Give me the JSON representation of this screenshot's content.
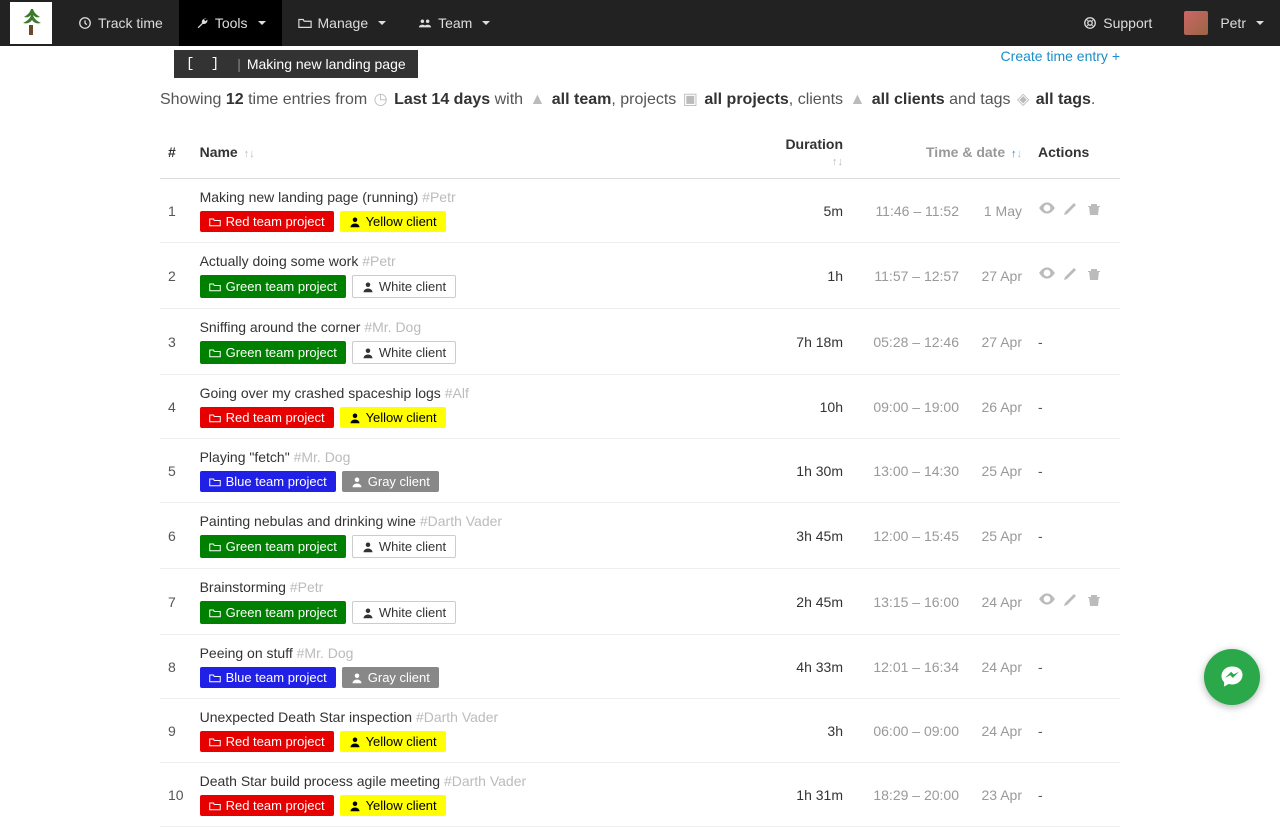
{
  "navbar": {
    "track_time": "Track time",
    "tools": "Tools",
    "manage": "Manage",
    "team": "Team",
    "support": "Support",
    "user_name": "Petr"
  },
  "breadcrumb": {
    "brackets": "[  ]",
    "title": "Making new landing page"
  },
  "create_link": "Create time entry",
  "filter": {
    "prefix": "Showing ",
    "count": "12",
    "after_count": " time entries from ",
    "range": "Last 14 days",
    "with": " with ",
    "team": "all team",
    "projects_label": ", projects ",
    "projects": "all projects",
    "clients_label": ", clients ",
    "clients": "all clients",
    "tags_label": " and tags ",
    "tags": "all tags",
    "period": "."
  },
  "columns": {
    "idx": "#",
    "name": "Name",
    "duration": "Duration",
    "timedate": "Time & date",
    "actions": "Actions"
  },
  "entries": [
    {
      "idx": "1",
      "title": "Making new landing page (running)",
      "assignee": "#Petr",
      "project": {
        "label": "Red team project",
        "class": "badge-red"
      },
      "client": {
        "label": "Yellow client",
        "class": "badge-yellow"
      },
      "duration": "5m",
      "time": "11:46 – 11:52",
      "date": "1 May",
      "actions": true
    },
    {
      "idx": "2",
      "title": "Actually doing some work",
      "assignee": "#Petr",
      "project": {
        "label": "Green team project",
        "class": "badge-green"
      },
      "client": {
        "label": "White client",
        "class": "badge-white"
      },
      "duration": "1h",
      "time": "11:57 – 12:57",
      "date": "27 Apr",
      "actions": true
    },
    {
      "idx": "3",
      "title": "Sniffing around the corner",
      "assignee": "#Mr. Dog",
      "project": {
        "label": "Green team project",
        "class": "badge-green"
      },
      "client": {
        "label": "White client",
        "class": "badge-white"
      },
      "duration": "7h 18m",
      "time": "05:28 – 12:46",
      "date": "27 Apr",
      "actions": false
    },
    {
      "idx": "4",
      "title": "Going over my crashed spaceship logs",
      "assignee": "#Alf",
      "project": {
        "label": "Red team project",
        "class": "badge-red"
      },
      "client": {
        "label": "Yellow client",
        "class": "badge-yellow"
      },
      "duration": "10h",
      "time": "09:00 – 19:00",
      "date": "26 Apr",
      "actions": false
    },
    {
      "idx": "5",
      "title": "Playing \"fetch\"",
      "assignee": "#Mr. Dog",
      "project": {
        "label": "Blue team project",
        "class": "badge-blue"
      },
      "client": {
        "label": "Gray client",
        "class": "badge-gray"
      },
      "duration": "1h 30m",
      "time": "13:00 – 14:30",
      "date": "25 Apr",
      "actions": false
    },
    {
      "idx": "6",
      "title": "Painting nebulas and drinking wine",
      "assignee": "#Darth Vader",
      "project": {
        "label": "Green team project",
        "class": "badge-green"
      },
      "client": {
        "label": "White client",
        "class": "badge-white"
      },
      "duration": "3h 45m",
      "time": "12:00 – 15:45",
      "date": "25 Apr",
      "actions": false
    },
    {
      "idx": "7",
      "title": "Brainstorming",
      "assignee": "#Petr",
      "project": {
        "label": "Green team project",
        "class": "badge-green"
      },
      "client": {
        "label": "White client",
        "class": "badge-white"
      },
      "duration": "2h 45m",
      "time": "13:15 – 16:00",
      "date": "24 Apr",
      "actions": true
    },
    {
      "idx": "8",
      "title": "Peeing on stuff",
      "assignee": "#Mr. Dog",
      "project": {
        "label": "Blue team project",
        "class": "badge-blue"
      },
      "client": {
        "label": "Gray client",
        "class": "badge-gray"
      },
      "duration": "4h 33m",
      "time": "12:01 – 16:34",
      "date": "24 Apr",
      "actions": false
    },
    {
      "idx": "9",
      "title": "Unexpected Death Star inspection",
      "assignee": "#Darth Vader",
      "project": {
        "label": "Red team project",
        "class": "badge-red"
      },
      "client": {
        "label": "Yellow client",
        "class": "badge-yellow"
      },
      "duration": "3h",
      "time": "06:00 – 09:00",
      "date": "24 Apr",
      "actions": false
    },
    {
      "idx": "10",
      "title": "Death Star build process agile meeting",
      "assignee": "#Darth Vader",
      "project": {
        "label": "Red team project",
        "class": "badge-red"
      },
      "client": {
        "label": "Yellow client",
        "class": "badge-yellow"
      },
      "duration": "1h 31m",
      "time": "18:29 – 20:00",
      "date": "23 Apr",
      "actions": false
    }
  ]
}
